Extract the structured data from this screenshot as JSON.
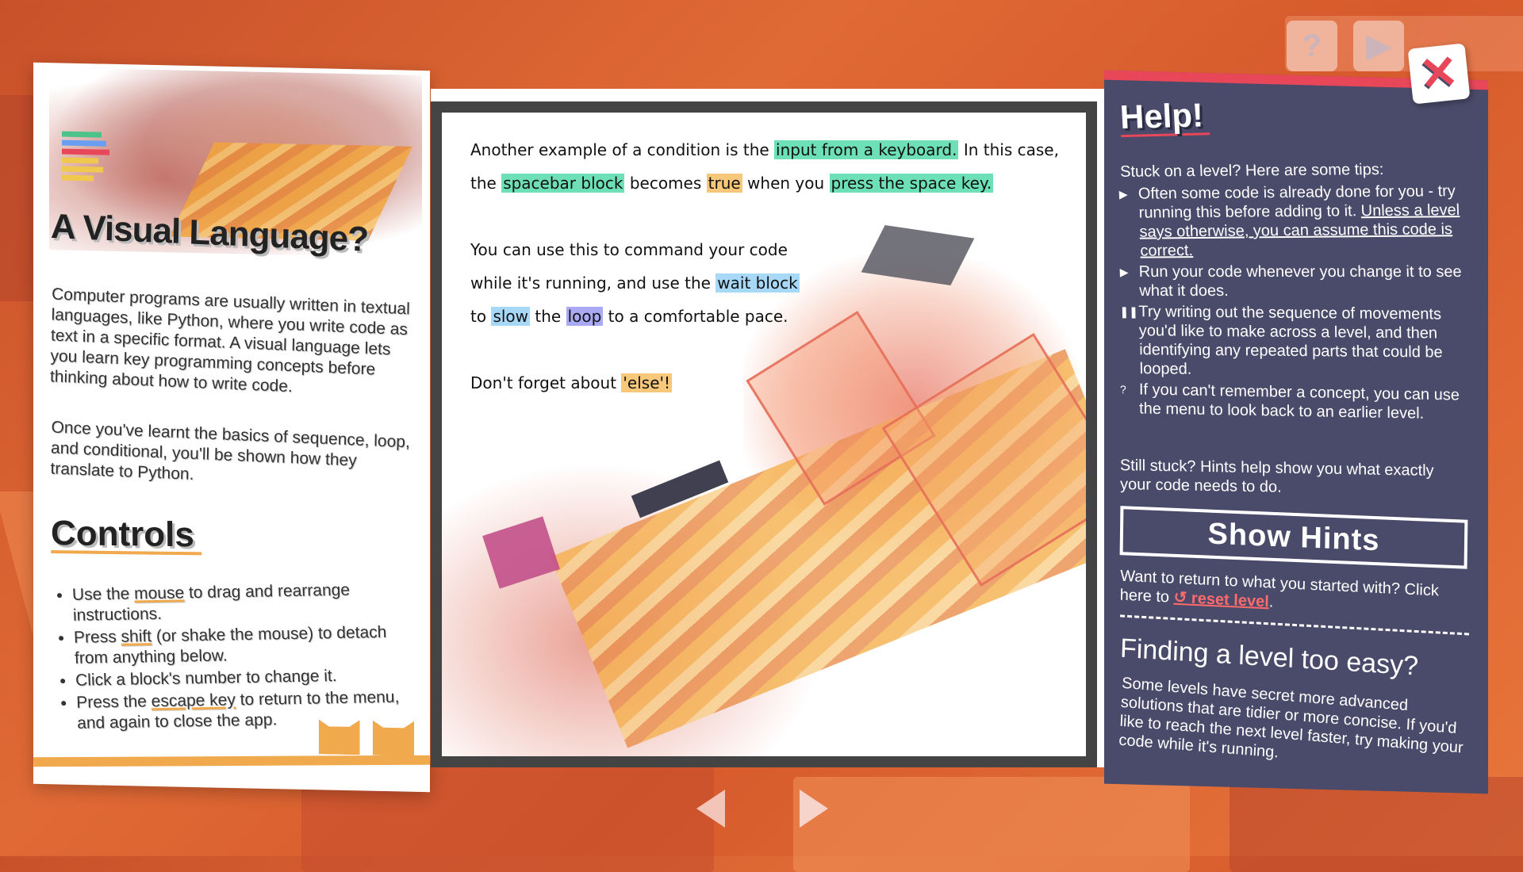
{
  "left": {
    "title": "A Visual Language?",
    "p1": "Computer programs are usually written in textual languages, like Python, where you write code as text in a specific format. A visual language lets you learn key programming concepts before thinking about how to write code.",
    "p2": "Once you've learnt the basics of sequence, loop, and conditional, you'll be shown how they translate to Python.",
    "controls_title": "Controls",
    "controls": [
      {
        "pre": "Use the ",
        "key": "mouse",
        "post": " to drag and rearrange instructions."
      },
      {
        "pre": "Press ",
        "key": "shift",
        "post": " (or shake the mouse) to detach from anything below."
      },
      {
        "pre": "Click a block's number to change it.",
        "key": "",
        "post": ""
      },
      {
        "pre": "Press the ",
        "key": "escape key",
        "post": " to return to the menu, and again to close the app."
      }
    ]
  },
  "center": {
    "para1": {
      "t1": "Another example of a condition is the ",
      "h1": "input from a keyboard.",
      "t2": " In this case, the ",
      "h2": "spacebar block",
      "t3": " becomes ",
      "h3": "true",
      "t4": " when you ",
      "h4": "press the space key."
    },
    "para2": {
      "t1": "You can use this to command your code while it's running, and use the ",
      "h1": "wait block",
      "t2": " to ",
      "h2": "slow",
      "t3": " the ",
      "h3": "loop",
      "t4": " to a comfortable pace."
    },
    "para3": {
      "t1": "Don't forget about ",
      "h1": "'else'!"
    }
  },
  "right": {
    "title": "Help!",
    "intro": "Stuck on a level? Here are some tips:",
    "tips": [
      {
        "marker": "▶",
        "text": "Often some code is already done for you - try running this before adding to it. ",
        "underlined": "Unless a level says otherwise, you can assume this code is correct."
      },
      {
        "marker": "▶",
        "text": "Run your code whenever you change it to see what it does.",
        "underlined": ""
      },
      {
        "marker": "❚❚",
        "text": "Try writing out the sequence of movements you'd like to make across a level, and then identifying any repeated parts that could be looped.",
        "underlined": ""
      },
      {
        "marker": "?",
        "text": "If you can't remember a concept, you can use the menu to look back to an earlier level.",
        "underlined": ""
      }
    ],
    "stuck": "Still stuck? Hints help show you what exactly your code needs to do.",
    "hints_button": "Show Hints",
    "reset_text": "Want to return to what you started with? Click here to ",
    "reset_link": "↺ reset level",
    "reset_end": ".",
    "easy_title": "Finding a level too easy?",
    "easy_text": "Some levels have secret more advanced solutions that are tidier or more concise. If you'd like to reach the next level faster, try making your code while it's running."
  },
  "icons": {
    "close": "✕",
    "help_ghost": "?",
    "play_ghost": "▶"
  },
  "colors": {
    "accent_red": "#e8475a",
    "panel": "#4a4a6a",
    "orange": "#f0a94d",
    "hl_green": "#6ee0b8",
    "hl_orange": "#f7c87a",
    "hl_blue": "#a8d8f8",
    "hl_purple": "#a9a9f5"
  }
}
